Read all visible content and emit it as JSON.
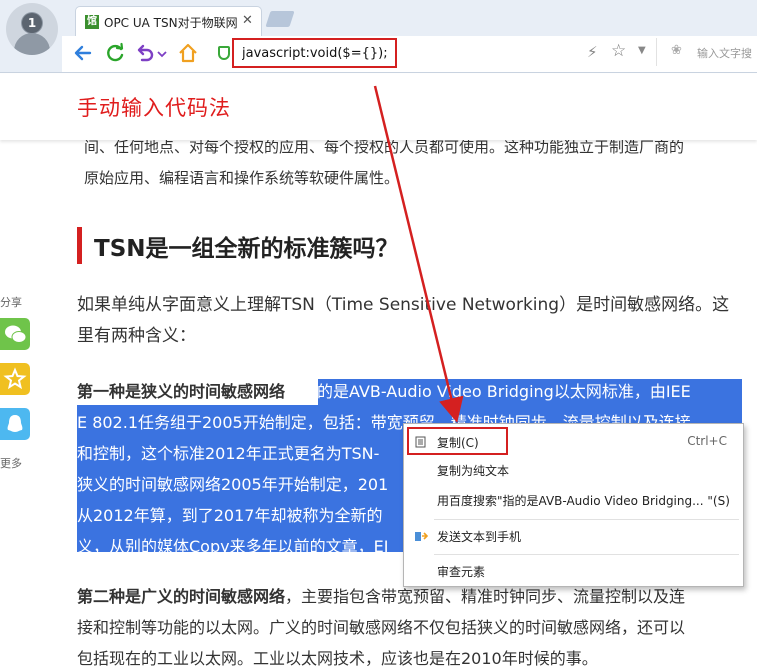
{
  "browser": {
    "avatar_badge": "1",
    "tab_title": "OPC UA TSN对于物联网",
    "tab_close": "✕",
    "address_value": "javascript:void($={});",
    "search_placeholder": "输入文字搜",
    "icons": [
      "back-icon",
      "refresh-icon",
      "undo-icon",
      "home-icon",
      "shield-icon",
      "bolt-icon",
      "star-icon",
      "chevron-down-icon",
      "paw-icon"
    ]
  },
  "annotation": {
    "title": "手动输入代码法",
    "color": "#e01d1d"
  },
  "article": {
    "intro_line1": "间、任何地点、对每个授权的应用、每个授权的人员都可使用。这种功能独立于制造厂商的",
    "intro_line2": "原始应用、编程语言和操作系统等软硬件属性。",
    "heading": "TSN是一组全新的标准簇吗？",
    "p1_line1": "如果单纯从字面意义上理解TSN（Time Sensitive Networking）是时间敏感网络。这",
    "p1_line2": "里有两种含义：",
    "p2_bold": "第一种是狭义的时间敏感网络",
    "p2_rest_line1": "，指的是AVB-Audio Video Bridging以太网标准，由IEE",
    "p2_line2": "E 802.1任务组于2005开始制定，包括：带宽预留、精准时钟同步、流量控制以及连接",
    "p2_line3": "和控制，这个标准2012年正式更名为TSN-",
    "p2_line4": "狭义的时间敏感网络2005年开始制定，201",
    "p2_line5": "从2012年算，到了2017年却被称为全新的",
    "p2_line6": "义，从别的媒体Copy来多年以前的文章，EI",
    "p3_bold": "第二种是广义的时间敏感网络",
    "p3_rest_line1": "，主要指包含带宽预留、精准时钟同步、流量控制以及连",
    "p3_line2": "接和控制等功能的以太网。广义的时间敏感网络不仅包括狭义的时间敏感网络，还可以",
    "p3_line3": "包括现在的工业以太网。工业以太网技术，应该也是在2010年时候的事。"
  },
  "share": {
    "label": "分享",
    "more": "更多",
    "buttons": [
      {
        "name": "wechat-icon",
        "color": "#6fc44a"
      },
      {
        "name": "qzone-star-icon",
        "color": "#f0c020"
      },
      {
        "name": "qq-icon",
        "color": "#4db8f0"
      }
    ]
  },
  "context_menu": {
    "items": [
      {
        "label": "复制(C)",
        "shortcut": "Ctrl+C"
      },
      {
        "label": "复制为纯文本",
        "shortcut": ""
      },
      {
        "label": "用百度搜索\"指的是AVB-Audio Video Bridging... \"(S)",
        "shortcut": ""
      },
      {
        "label": "发送文本到手机",
        "shortcut": ""
      },
      {
        "label": "审查元素",
        "shortcut": ""
      }
    ]
  }
}
